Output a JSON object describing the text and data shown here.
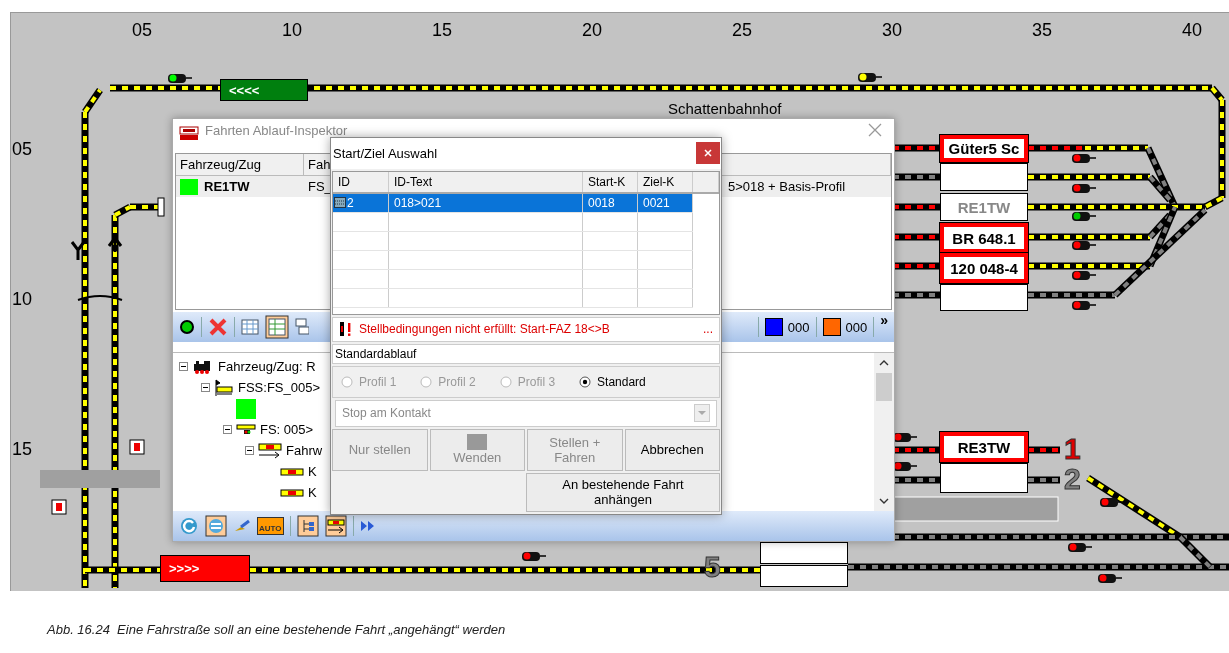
{
  "diagram": {
    "column_numbers": [
      "05",
      "10",
      "15",
      "20",
      "25",
      "30",
      "35",
      "40"
    ],
    "row_numbers": [
      "05",
      "10",
      "15"
    ],
    "area_label": "Schattenbahnhof",
    "train_blocks": [
      {
        "label": "<<<<",
        "color": "#007f0e"
      },
      {
        "label": ">>>>",
        "color": "#ff0000"
      }
    ],
    "station_blocks": [
      {
        "kind": "occupied",
        "label": "Güter5 Sc"
      },
      {
        "kind": "empty"
      },
      {
        "kind": "reserved",
        "label": "RE1TW"
      },
      {
        "kind": "occupied",
        "label": "BR 648.1"
      },
      {
        "kind": "occupied",
        "label": "120 048-4"
      },
      {
        "kind": "empty"
      },
      {
        "kind": "occupied",
        "label": "RE3TW"
      },
      {
        "kind": "empty"
      },
      {
        "kind": "empty"
      },
      {
        "kind": "empty"
      }
    ],
    "track_numbers": [
      {
        "label": "1",
        "color": "#e00000"
      },
      {
        "label": "2",
        "color": "#808080"
      },
      {
        "label": "5",
        "color": "#808080"
      }
    ]
  },
  "inspector": {
    "title": "Fahrten Ablauf-Inspektor",
    "columns": [
      "Fahrzeug/Zug",
      "Fah"
    ],
    "rows": [
      {
        "color": "#00ff00",
        "cells": [
          "RE1TW",
          "FS_",
          "5>018 + Basis-Profil"
        ]
      }
    ],
    "counters": [
      {
        "color": "#0000ff",
        "value": "000"
      },
      {
        "color": "#ff6600",
        "value": "000"
      }
    ],
    "more": "»",
    "tree": [
      {
        "kind": "loco",
        "label": "Fahrzeug/Zug: R",
        "expanded": true,
        "children": [
          {
            "kind": "route-set",
            "label": "FSS:FS_005>",
            "expanded": true,
            "children": [
              {
                "kind": "status",
                "color": "#00ff00"
              },
              {
                "kind": "route",
                "label": "FS: 005>",
                "expanded": true,
                "children": [
                  {
                    "kind": "path",
                    "label": "Fahrw",
                    "expanded": true,
                    "children": [
                      {
                        "kind": "contact",
                        "label": "K"
                      },
                      {
                        "kind": "contact",
                        "label": "K"
                      }
                    ]
                  }
                ]
              }
            ]
          }
        ]
      }
    ],
    "auto_label": "AUTO"
  },
  "dialog": {
    "title": "Start/Ziel Auswahl",
    "columns": [
      "ID",
      "ID-Text",
      "Start-K",
      "Ziel-K"
    ],
    "rows": [
      {
        "selected": true,
        "cells": [
          "2",
          "018>021",
          "0018",
          "0021"
        ]
      }
    ],
    "status": {
      "message": "Stellbedingungen nicht erfüllt: Start-FAZ 18<>B",
      "more": "..."
    },
    "profile_name": "Standardablauf",
    "profiles": [
      {
        "label": "Profil 1",
        "selected": false,
        "disabled": true
      },
      {
        "label": "Profil 2",
        "selected": false,
        "disabled": true
      },
      {
        "label": "Profil 3",
        "selected": false,
        "disabled": true
      },
      {
        "label": "Standard",
        "selected": true,
        "disabled": false
      }
    ],
    "stop_mode": {
      "value": "Stop am Kontakt",
      "disabled": true
    },
    "buttons": [
      {
        "label": "Nur stellen",
        "disabled": true,
        "icon": false
      },
      {
        "label": "Wenden",
        "disabled": true,
        "icon": true
      },
      {
        "label": "Stellen + Fahren",
        "disabled": true,
        "icon": false
      },
      {
        "label": "Abbrechen",
        "disabled": false,
        "icon": false
      }
    ],
    "append_button": "An bestehende Fahrt anhängen"
  },
  "caption": "Abb. 16.24  Eine Fahrstraße soll an eine bestehende Fahrt „angehängt“ werden"
}
